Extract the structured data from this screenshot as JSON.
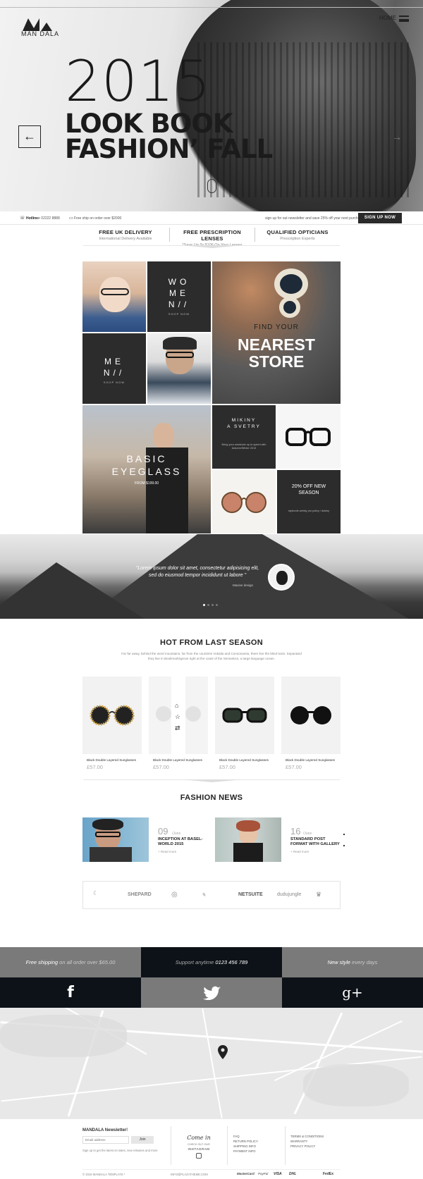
{
  "header": {
    "logo_text": "MAN DALA",
    "home_label": "HOME",
    "hero_year": "2015",
    "hero_line1": "LOOK BOOK",
    "hero_line2": "FASHION’ FALL",
    "prev_arrow": "←",
    "next_arrow": "→"
  },
  "topbar": {
    "hotline_label": "Hotline:",
    "hotline_number": "+ 02222 8888",
    "free_ship": "Free ship on order over $2000",
    "newsletter": "sign up for out newsletter and save 25% off your next purchase",
    "signup_button": "SIGN UP NOW"
  },
  "features": [
    {
      "title": "FREE UK DELIVERY",
      "sub": "International Delivery Available"
    },
    {
      "title": "FREE PRESCRIPTION LENSES",
      "sub": "*Save Up To $106 On Your Lenses"
    },
    {
      "title": "QUALIFIED OPTICIANS",
      "sub": "Prescription Experts"
    }
  ],
  "grid": {
    "women_l1": "WO",
    "women_l2": "ME",
    "women_l3": "N//",
    "women_shop": "SHOP NOW",
    "men_l1": "ME",
    "men_l2": "N//",
    "men_shop": "SHOP NOW",
    "store_find": "FIND YOUR",
    "store_l1": "NEAREST",
    "store_l2": "STORE",
    "basic_l1": "BASIC",
    "basic_l2": "EYEGLASS",
    "basic_price": "FROM $199.00",
    "mikiny_l1": "MIKINY",
    "mikiny_l2": "A SVETRY",
    "mikiny_text": "Bring your wardrobe up to speed with Autumn/Winter 2013",
    "season_l1": "20% OFF  NEW",
    "season_l2": "SEASON",
    "season_text": "stylevole webky pro policy / doleky"
  },
  "testimonial": {
    "quote_l1": "\"Lorem ipsum dolor sit amet, consectetur adipisicing elit,",
    "quote_l2": "sed do eiusmod tempor incididunt ut labore \"",
    "author": "Maxine design"
  },
  "hot_section": {
    "title": "HOT FROM LAST SEASON",
    "sub_l1": "Far far away, behind the word mountains, far from the countries Vokalia and Consonantia, there live the blind texts. Separated",
    "sub_l2": "they live in Bookmarksgrove right at the coast of the Semantics, a large language ocean.",
    "products": [
      {
        "name": "Black Double Layered Sunglasses",
        "price": "£57.00"
      },
      {
        "name": "Black Double Layered Sunglasses",
        "price": "£57.00"
      },
      {
        "name": "Black Double Layered Sunglasses",
        "price": "£57.00"
      },
      {
        "name": "Black Double Layered Sunglasses",
        "price": "£57.00"
      }
    ]
  },
  "news_section": {
    "title": "FASHION NEWS",
    "items": [
      {
        "day": "09",
        "month": "/June",
        "title_l1": "INCEPTION AT BASEL-",
        "title_l2": "WORLD 2015",
        "more": "+ Read more"
      },
      {
        "day": "16",
        "month": "/June",
        "title_l1": "STANDARD POST",
        "title_l2": "FORMAT WITH GALLERY",
        "more": "+ Read more"
      }
    ]
  },
  "brands": [
    "SHEPARD",
    "NETSUITE",
    "dudujungle"
  ],
  "bands": {
    "ship_a": "Free shipping",
    "ship_b": " on all order over $65.00",
    "support_a": "Support anytime",
    "support_b": " 0123 456 789",
    "style_a": "New style",
    "style_b": " every days",
    "facebook": "f",
    "googleplus": "g+"
  },
  "footer": {
    "newsletter_title": "MANDALA Newsletter!",
    "email_placeholder": "Email address",
    "join_button": "Join",
    "newsletter_hint": "Sign up to get the latest on sales, new releases and more",
    "instagram_script": "Come in",
    "instagram_sub": "CHECK OUT OUR",
    "instagram_label": "INSTAGRAM",
    "links_a": [
      "FAQ",
      "RETURN POLICY",
      "SHIPPING INFO",
      "PAYMENT INFO"
    ],
    "links_b": [
      "TERMS & CONDITIONS",
      "WARRANTY",
      "PRIVACY POLICY"
    ],
    "copyright": "© 2016 MANDALA TEMPLATE *",
    "email": "INFO@PLAZATHEME.COM",
    "payments": [
      "MasterCard",
      "PayPal",
      "VISA",
      "DHL",
      "FedEx"
    ]
  },
  "colors": {
    "dark": "#2c2c2c",
    "grey_band": "#7a7a7a",
    "navy_band": "#0d1218"
  }
}
